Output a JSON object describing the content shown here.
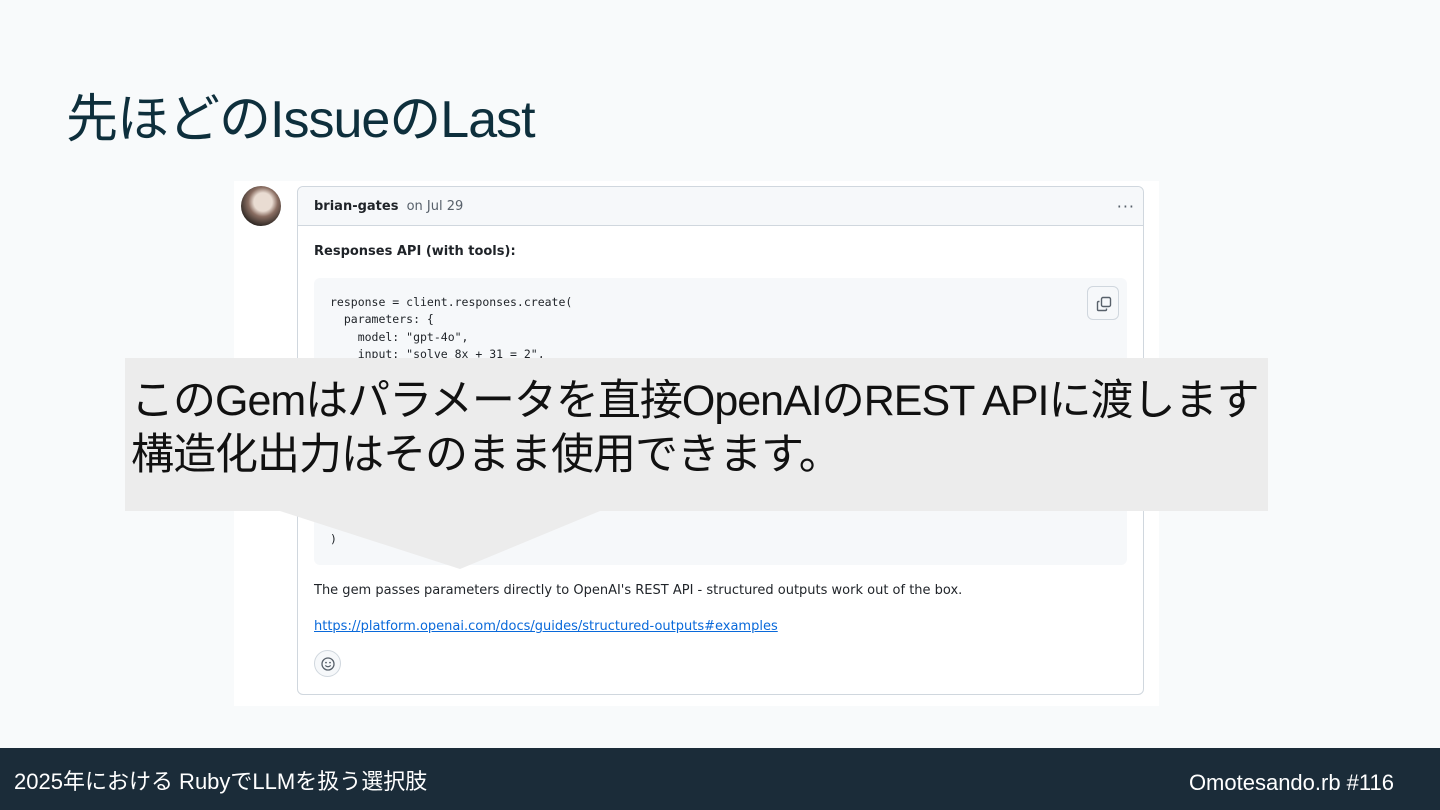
{
  "slide": {
    "title": "先ほどのIssueのLast"
  },
  "comment": {
    "author": "brian-gates",
    "date": "on Jul 29",
    "menu_icon": "kebab-horizontal-icon",
    "section_label": "Responses API (with tools):",
    "code_lines": [
      "response = client.responses.create(",
      "  parameters: {",
      "    model: \"gpt-4o\",",
      "    input: \"solve 8x + 31 = 2\","
    ],
    "code_tail_lines": [
      "  }",
      ")"
    ],
    "copy_icon": "copy-icon",
    "body_text": "The gem passes parameters directly to OpenAI's REST API - structured outputs work out of the box.",
    "link_text": "https://platform.openai.com/docs/guides/structured-outputs#examples",
    "reaction_icon": "smiley-icon"
  },
  "callout": {
    "text": "このGemはパラメータを直接OpenAIのREST APIに渡します 構造化出力はそのまま使用できます。"
  },
  "footer": {
    "left_text": "2025年における RubyでLLMを扱う選択肢",
    "right_text": "Omotesando.rb #116",
    "background": "#1b2c39"
  }
}
